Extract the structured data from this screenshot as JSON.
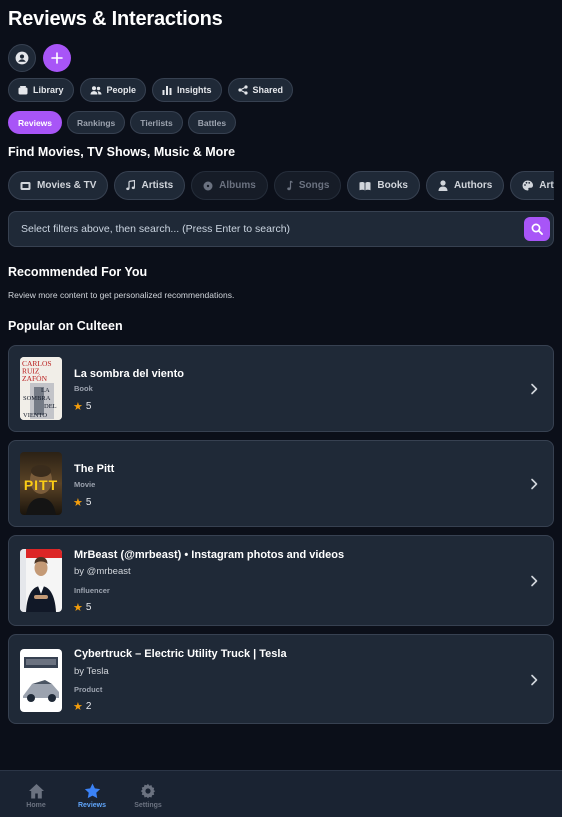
{
  "header": {
    "title": "Reviews & Interactions"
  },
  "nav_pills": [
    {
      "label": "Library",
      "icon": "library-icon"
    },
    {
      "label": "People",
      "icon": "people-icon"
    },
    {
      "label": "Insights",
      "icon": "insights-icon"
    },
    {
      "label": "Shared",
      "icon": "share-icon"
    }
  ],
  "sub_tabs": [
    "Reviews",
    "Rankings",
    "Tierlists",
    "Battles"
  ],
  "find_heading": "Find Movies, TV Shows, Music & More",
  "categories": [
    {
      "label": "Movies & TV",
      "icon": "film-icon",
      "enabled": true
    },
    {
      "label": "Artists",
      "icon": "music-note-icon",
      "enabled": true
    },
    {
      "label": "Albums",
      "icon": "disc-icon",
      "enabled": false
    },
    {
      "label": "Songs",
      "icon": "music-note-icon",
      "enabled": false
    },
    {
      "label": "Books",
      "icon": "book-icon",
      "enabled": true
    },
    {
      "label": "Authors",
      "icon": "person-icon",
      "enabled": true
    },
    {
      "label": "Artworks",
      "icon": "palette-icon",
      "enabled": true
    }
  ],
  "search": {
    "placeholder": "Select filters above, then search... (Press Enter to search)"
  },
  "recommended": {
    "heading": "Recommended For You",
    "message": "Review more content to get personalized recommendations."
  },
  "popular": {
    "heading": "Popular on Culteen",
    "items": [
      {
        "title": "La sombra del viento",
        "by": "",
        "type": "Book",
        "rating": "5"
      },
      {
        "title": "The Pitt",
        "by": "",
        "type": "Movie",
        "rating": "5"
      },
      {
        "title": "MrBeast (@mrbeast) • Instagram photos and videos",
        "by": "by @mrbeast",
        "type": "Influencer",
        "rating": "5"
      },
      {
        "title": "Cybertruck – Electric Utility Truck | Tesla",
        "by": "by Tesla",
        "type": "Product",
        "rating": "2"
      }
    ]
  },
  "book_cover_text": [
    "CARLOS",
    "RUIZ",
    "ZAFÓN",
    "LA",
    "SOMBRA",
    "DEL",
    "VIENTO"
  ],
  "pitt_cover_text": "PITT",
  "bottom_nav": [
    {
      "label": "Home",
      "icon": "home-icon"
    },
    {
      "label": "Reviews",
      "icon": "star-icon"
    },
    {
      "label": "Settings",
      "icon": "gear-icon"
    }
  ],
  "colors": {
    "accent": "#a855f7",
    "background": "#0b0f19",
    "card": "#1f2937",
    "star": "#f59e0b",
    "active_tab": "#60a5fa"
  }
}
